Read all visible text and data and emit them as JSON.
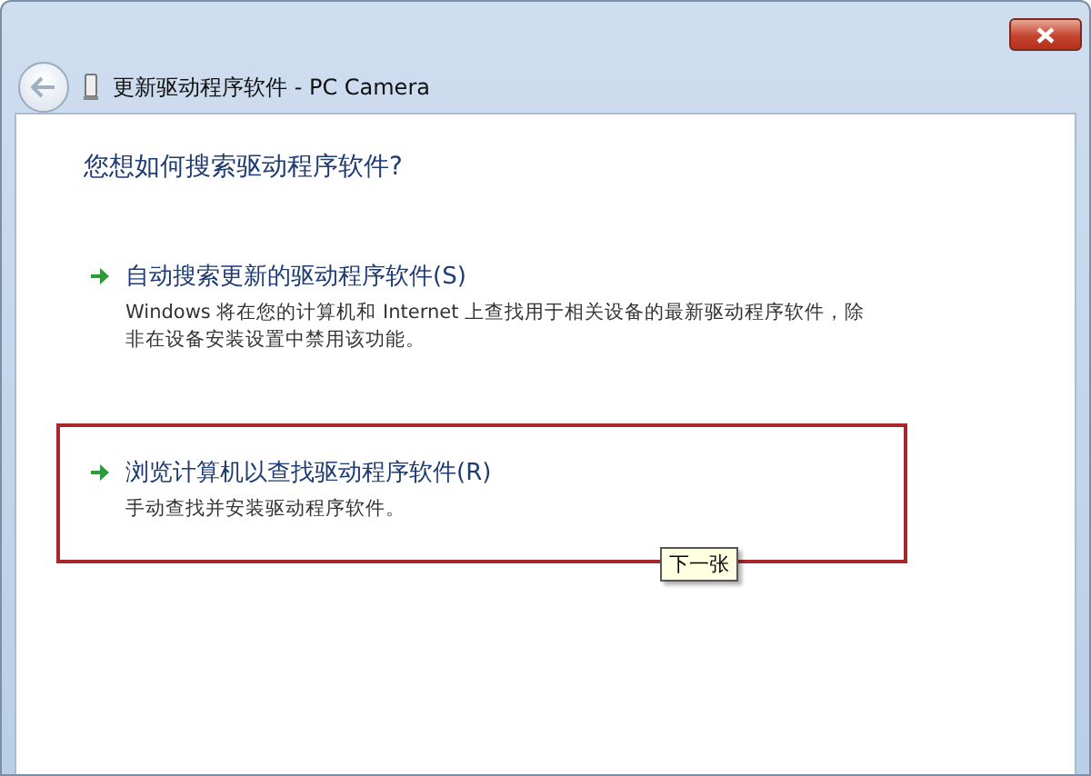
{
  "window": {
    "title": "更新驱动程序软件 - PC Camera"
  },
  "heading": "您想如何搜索驱动程序软件?",
  "options": [
    {
      "title": "自动搜索更新的驱动程序软件(S)",
      "description": "Windows 将在您的计算机和 Internet 上查找用于相关设备的最新驱动程序软件，除非在设备安装设置中禁用该功能。",
      "highlighted": false
    },
    {
      "title": "浏览计算机以查找驱动程序软件(R)",
      "description": "手动查找并安装驱动程序软件。",
      "highlighted": true
    }
  ],
  "tooltip": "下一张"
}
